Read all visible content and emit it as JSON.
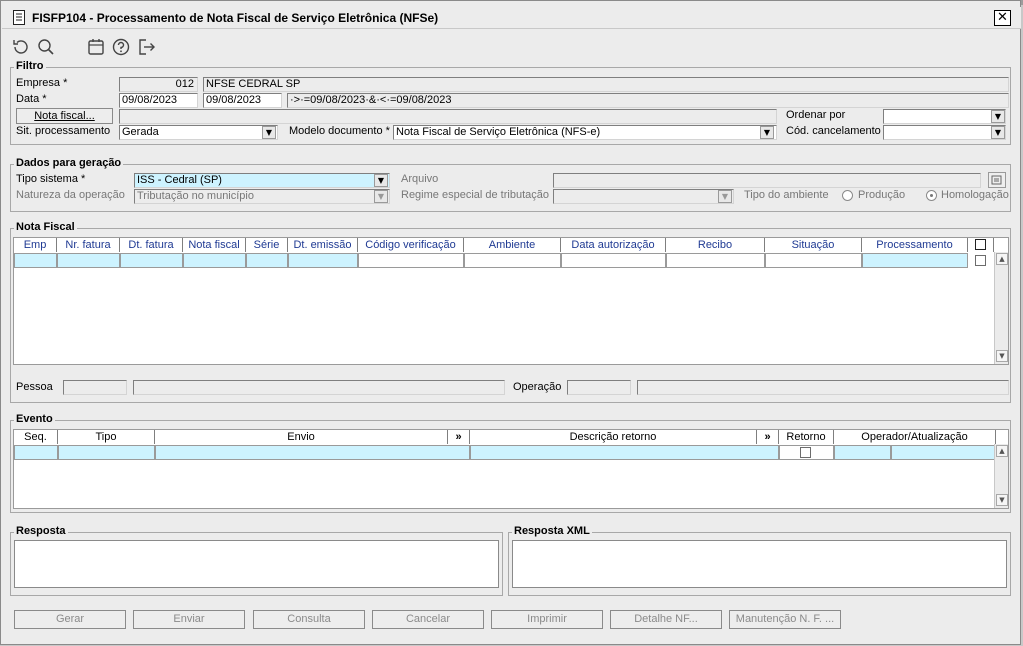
{
  "window": {
    "title": "FISFP104 - Processamento de Nota Fiscal de Serviço Eletrônica (NFSe)",
    "close": "✕"
  },
  "toolbar": {
    "icons": [
      "refresh-icon",
      "search-icon",
      "calendar-icon",
      "help-icon",
      "exit-icon"
    ]
  },
  "filtro": {
    "legend": "Filtro",
    "empresa_label": "Empresa *",
    "empresa_code": "012",
    "empresa_name": "NFSE CEDRAL SP",
    "data_label": "Data *",
    "data_from": "09/08/2023",
    "data_to": "09/08/2023",
    "data_expr": "·>·=09/08/2023·&·<·=09/08/2023",
    "nota_button": "Nota fiscal...",
    "nota_value": "",
    "ordenar_label": "Ordenar por",
    "ordenar_value": "",
    "sit_label": "Sit. processamento",
    "sit_value": "Gerada",
    "modelo_label": "Modelo documento *",
    "modelo_value": "Nota Fiscal de Serviço Eletrônica (NFS-e)",
    "cod_label": "Cód. cancelamento",
    "cod_value": ""
  },
  "dados": {
    "legend": "Dados para geração",
    "tipo_label": "Tipo sistema *",
    "tipo_value": "ISS - Cedral (SP)",
    "arquivo_label": "Arquivo",
    "natureza_label": "Natureza da operação",
    "natureza_value": "Tributação no município",
    "regime_label": "Regime especial de tributação",
    "regime_value": "",
    "ambiente_label": "Tipo do ambiente",
    "producao": "Produção",
    "homologacao": "Homologação",
    "selected_ambiente": "Homologação"
  },
  "nota_fiscal": {
    "legend": "Nota Fiscal",
    "columns": [
      "Emp",
      "Nr. fatura",
      "Dt. fatura",
      "Nota fiscal",
      "Série",
      "Dt. emissão",
      "Código verificação",
      "Ambiente",
      "Data autorização",
      "Recibo",
      "Situação",
      "Processamento"
    ],
    "pessoa_label": "Pessoa",
    "operacao_label": "Operação"
  },
  "evento": {
    "legend": "Evento",
    "columns": [
      "Seq.",
      "Tipo",
      "Envio",
      "»",
      "Descrição retorno",
      "»",
      "Retorno",
      "Operador/Atualização"
    ]
  },
  "resposta": {
    "legend": "Resposta"
  },
  "resposta_xml": {
    "legend": "Resposta XML"
  },
  "buttons": [
    "Gerar",
    "Enviar",
    "Consulta",
    "Cancelar",
    "Imprimir",
    "Detalhe NF...",
    "Manutenção N. F. ..."
  ],
  "colors": {
    "selected_row": "#cdf3ff",
    "header_text": "#1f3a93",
    "window_bg": "#ececec"
  }
}
